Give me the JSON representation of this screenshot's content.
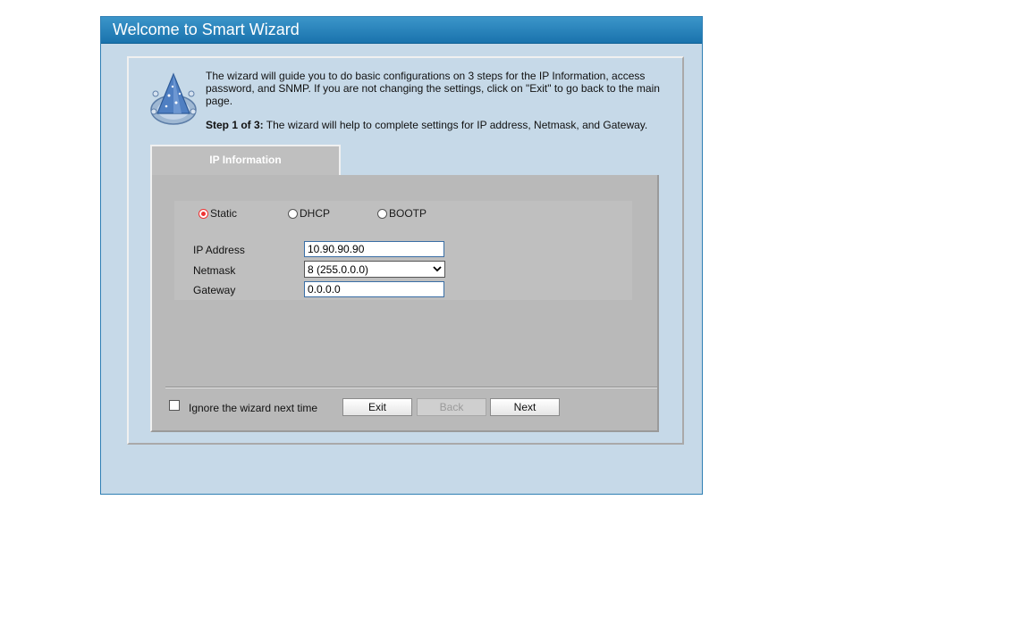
{
  "window": {
    "title": "Welcome to Smart Wizard"
  },
  "intro": {
    "text": "The wizard will guide you to do basic configurations on 3 steps for the IP Information, access password, and SNMP. If you are not changing the settings, click on \"Exit\" to go back to the main page.",
    "step_label": "Step 1 of 3:",
    "step_text": " The wizard will help to complete settings for IP address, Netmask, and Gateway."
  },
  "tab": {
    "label": "IP Information"
  },
  "mode": {
    "selected": "Static",
    "options": [
      {
        "label": "Static",
        "checked": true
      },
      {
        "label": "DHCP",
        "checked": false
      },
      {
        "label": "BOOTP",
        "checked": false
      }
    ]
  },
  "fields": {
    "ip_address": {
      "label": "IP Address",
      "value": "10.90.90.90"
    },
    "netmask": {
      "label": "Netmask",
      "value": "8 (255.0.0.0)"
    },
    "gateway": {
      "label": "Gateway",
      "value": "0.0.0.0"
    }
  },
  "footer": {
    "ignore_label": "Ignore the wizard next time",
    "ignore_checked": false,
    "exit_label": "Exit",
    "back_label": "Back",
    "back_enabled": false,
    "next_label": "Next"
  },
  "icons": {
    "wizard_logo": "wizard-hat-icon",
    "dropdown": "chevron-down-icon"
  },
  "colors": {
    "title_bar": "#1a73ad",
    "panel_background": "#c6d9e8",
    "form_background": "#b9b9b9",
    "radio_selected": "#e33333"
  }
}
